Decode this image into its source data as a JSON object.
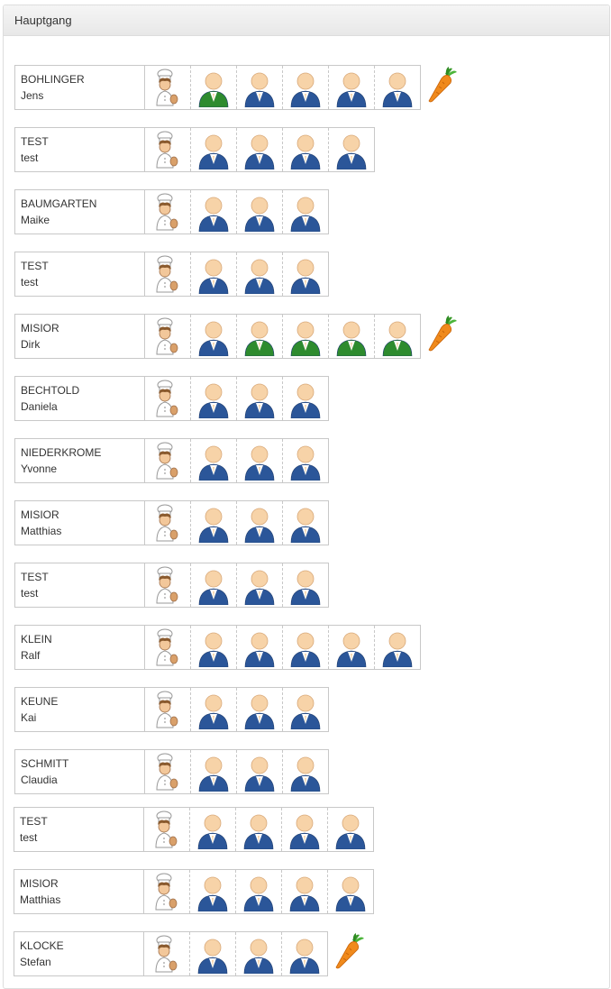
{
  "panel": {
    "title": "Hauptgang"
  },
  "colors": {
    "blue": "#2b5699",
    "green": "#2e8b2e",
    "skin": "#f7d3a8"
  },
  "rows": [
    {
      "last": "BOHLINGER",
      "first": "Jens",
      "persons": [
        "green",
        "blue",
        "blue",
        "blue",
        "blue"
      ],
      "carrot": true
    },
    {
      "last": "TEST",
      "first": "test",
      "persons": [
        "blue",
        "blue",
        "blue",
        "blue"
      ],
      "carrot": false
    },
    {
      "last": "BAUMGARTEN",
      "first": "Maike",
      "persons": [
        "blue",
        "blue",
        "blue"
      ],
      "carrot": false
    },
    {
      "last": "TEST",
      "first": "test",
      "persons": [
        "blue",
        "blue",
        "blue"
      ],
      "carrot": false
    },
    {
      "last": "MISIOR",
      "first": "Dirk",
      "persons": [
        "blue",
        "green",
        "green",
        "green",
        "green"
      ],
      "carrot": true
    },
    {
      "last": "BECHTOLD",
      "first": "Daniela",
      "persons": [
        "blue",
        "blue",
        "blue"
      ],
      "carrot": false
    },
    {
      "last": "NIEDERKROME",
      "first": "Yvonne",
      "persons": [
        "blue",
        "blue",
        "blue"
      ],
      "carrot": false
    },
    {
      "last": "MISIOR",
      "first": "Matthias",
      "persons": [
        "blue",
        "blue",
        "blue"
      ],
      "carrot": false
    },
    {
      "last": "TEST",
      "first": "test",
      "persons": [
        "blue",
        "blue",
        "blue"
      ],
      "carrot": false
    },
    {
      "last": "KLEIN",
      "first": "Ralf",
      "persons": [
        "blue",
        "blue",
        "blue",
        "blue",
        "blue"
      ],
      "carrot": false
    },
    {
      "last": "KEUNE",
      "first": "Kai",
      "persons": [
        "blue",
        "blue",
        "blue"
      ],
      "carrot": false
    },
    {
      "last": "SCHMITT",
      "first": "Claudia",
      "persons": [
        "blue",
        "blue",
        "blue"
      ],
      "carrot": false
    },
    {
      "last": "TEST",
      "first": "test",
      "persons": [
        "blue",
        "blue",
        "blue",
        "blue"
      ],
      "carrot": false
    },
    {
      "last": "MISIOR",
      "first": "Matthias",
      "persons": [
        "blue",
        "blue",
        "blue",
        "blue"
      ],
      "carrot": false
    },
    {
      "last": "KLOCKE",
      "first": "Stefan",
      "persons": [
        "blue",
        "blue",
        "blue"
      ],
      "carrot": true
    }
  ]
}
